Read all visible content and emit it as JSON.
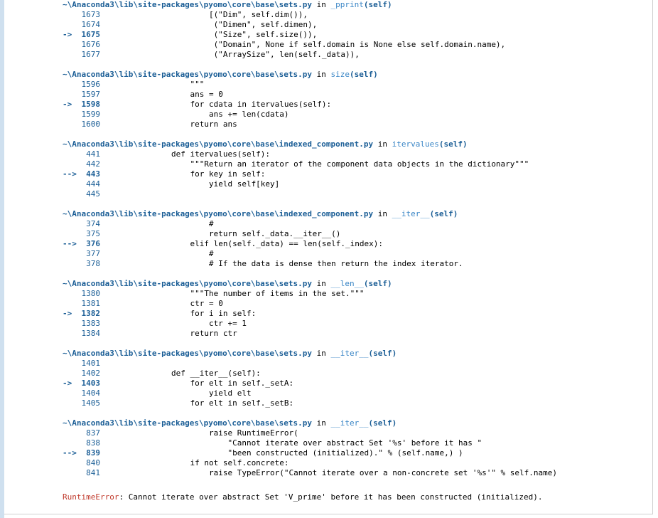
{
  "frames": [
    {
      "path": "~\\Anaconda3\\lib\\site-packages\\pyomo\\core\\base\\sets.py",
      "in": "in",
      "func": "_pprint",
      "args": "(self)",
      "lines": [
        {
          "arrow": "",
          "num": "1673",
          "code": "                [(\"Dim\", self.dim()),"
        },
        {
          "arrow": "",
          "num": "1674",
          "code": "                 (\"Dimen\", self.dimen),"
        },
        {
          "arrow": "->",
          "num": "1675",
          "code": "                 (\"Size\", self.size()),"
        },
        {
          "arrow": "",
          "num": "1676",
          "code": "                 (\"Domain\", None if self.domain is None else self.domain.name),"
        },
        {
          "arrow": "",
          "num": "1677",
          "code": "                 (\"ArraySize\", len(self._data)),"
        }
      ]
    },
    {
      "path": "~\\Anaconda3\\lib\\site-packages\\pyomo\\core\\base\\sets.py",
      "in": "in",
      "func": "size",
      "args": "(self)",
      "lines": [
        {
          "arrow": "",
          "num": "1596",
          "code": "            \"\"\""
        },
        {
          "arrow": "",
          "num": "1597",
          "code": "            ans = 0"
        },
        {
          "arrow": "->",
          "num": "1598",
          "code": "            for cdata in itervalues(self):"
        },
        {
          "arrow": "",
          "num": "1599",
          "code": "                ans += len(cdata)"
        },
        {
          "arrow": "",
          "num": "1600",
          "code": "            return ans"
        }
      ]
    },
    {
      "path": "~\\Anaconda3\\lib\\site-packages\\pyomo\\core\\base\\indexed_component.py",
      "in": "in",
      "func": "itervalues",
      "args": "(self)",
      "lines": [
        {
          "arrow": "",
          "num": "441",
          "code": "        def itervalues(self):"
        },
        {
          "arrow": "",
          "num": "442",
          "code": "            \"\"\"Return an iterator of the component data objects in the dictionary\"\"\""
        },
        {
          "arrow": "-->",
          "num": "443",
          "code": "            for key in self:"
        },
        {
          "arrow": "",
          "num": "444",
          "code": "                yield self[key]"
        },
        {
          "arrow": "",
          "num": "445",
          "code": ""
        }
      ]
    },
    {
      "path": "~\\Anaconda3\\lib\\site-packages\\pyomo\\core\\base\\indexed_component.py",
      "in": "in",
      "func": "__iter__",
      "args": "(self)",
      "lines": [
        {
          "arrow": "",
          "num": "374",
          "code": "                #"
        },
        {
          "arrow": "",
          "num": "375",
          "code": "                return self._data.__iter__()"
        },
        {
          "arrow": "-->",
          "num": "376",
          "code": "            elif len(self._data) == len(self._index):"
        },
        {
          "arrow": "",
          "num": "377",
          "code": "                #"
        },
        {
          "arrow": "",
          "num": "378",
          "code": "                # If the data is dense then return the index iterator."
        }
      ]
    },
    {
      "path": "~\\Anaconda3\\lib\\site-packages\\pyomo\\core\\base\\sets.py",
      "in": "in",
      "func": "__len__",
      "args": "(self)",
      "lines": [
        {
          "arrow": "",
          "num": "1380",
          "code": "            \"\"\"The number of items in the set.\"\"\""
        },
        {
          "arrow": "",
          "num": "1381",
          "code": "            ctr = 0"
        },
        {
          "arrow": "->",
          "num": "1382",
          "code": "            for i in self:"
        },
        {
          "arrow": "",
          "num": "1383",
          "code": "                ctr += 1"
        },
        {
          "arrow": "",
          "num": "1384",
          "code": "            return ctr"
        }
      ]
    },
    {
      "path": "~\\Anaconda3\\lib\\site-packages\\pyomo\\core\\base\\sets.py",
      "in": "in",
      "func": "__iter__",
      "args": "(self)",
      "lines": [
        {
          "arrow": "",
          "num": "1401",
          "code": ""
        },
        {
          "arrow": "",
          "num": "1402",
          "code": "        def __iter__(self):"
        },
        {
          "arrow": "->",
          "num": "1403",
          "code": "            for elt in self._setA:"
        },
        {
          "arrow": "",
          "num": "1404",
          "code": "                yield elt"
        },
        {
          "arrow": "",
          "num": "1405",
          "code": "            for elt in self._setB:"
        }
      ]
    },
    {
      "path": "~\\Anaconda3\\lib\\site-packages\\pyomo\\core\\base\\sets.py",
      "in": "in",
      "func": "__iter__",
      "args": "(self)",
      "lines": [
        {
          "arrow": "",
          "num": "837",
          "code": "                raise RuntimeError("
        },
        {
          "arrow": "",
          "num": "838",
          "code": "                    \"Cannot iterate over abstract Set '%s' before it has \""
        },
        {
          "arrow": "-->",
          "num": "839",
          "code": "                    \"been constructed (initialized).\" % (self.name,) )"
        },
        {
          "arrow": "",
          "num": "840",
          "code": "            if not self.concrete:"
        },
        {
          "arrow": "",
          "num": "841",
          "code": "                raise TypeError(\"Cannot iterate over a non-concrete set '%s'\" % self.name)"
        }
      ]
    }
  ],
  "error": {
    "name": "RuntimeError",
    "message": ": Cannot iterate over abstract Set 'V_prime' before it has been constructed (initialized)."
  },
  "colors": {
    "path": "#1b5e96",
    "func": "#3a86c6",
    "error": "#c0392b",
    "cell_bar": "#cfe0ef"
  }
}
